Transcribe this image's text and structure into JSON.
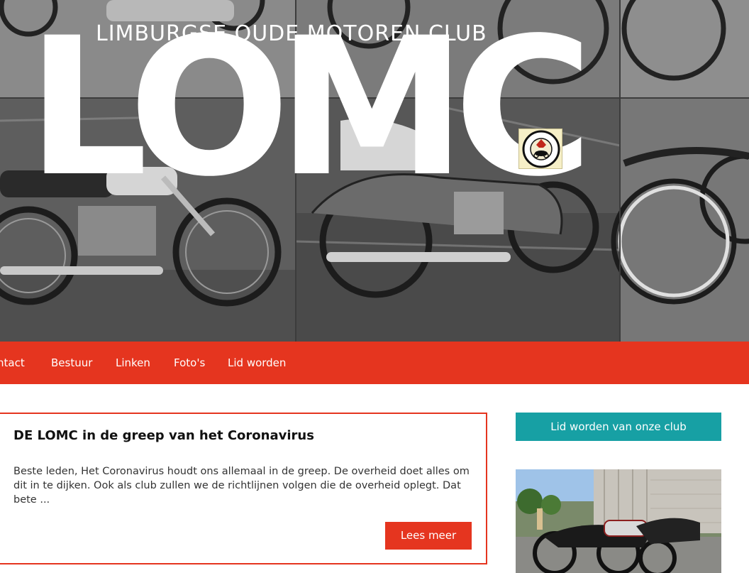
{
  "header": {
    "subtitle": "LIMBURGSE OUDE MOTOREN CLUB",
    "title": "LOMC",
    "badge_icon": "club-emblem-lion-motorcycle"
  },
  "nav": {
    "items": [
      {
        "label": "ntact"
      },
      {
        "label": "Bestuur"
      },
      {
        "label": "Linken"
      },
      {
        "label": "Foto's"
      },
      {
        "label": "Lid worden"
      }
    ]
  },
  "post": {
    "title": "DE LOMC in de greep van het Coronavirus",
    "excerpt": "Beste leden,   Het Coronavirus houdt ons allemaal in de greep. De overheid doet alles om dit in te dijken. Ook als club zullen we de richtlijnen volgen die de overheid oplegt. Dat bete ...",
    "read_more": "Lees meer"
  },
  "sidebar": {
    "join_button": "Lid worden van onze club"
  },
  "colors": {
    "accent_red": "#e5351f",
    "accent_teal": "#17a0a4",
    "text_dark": "#111111"
  }
}
